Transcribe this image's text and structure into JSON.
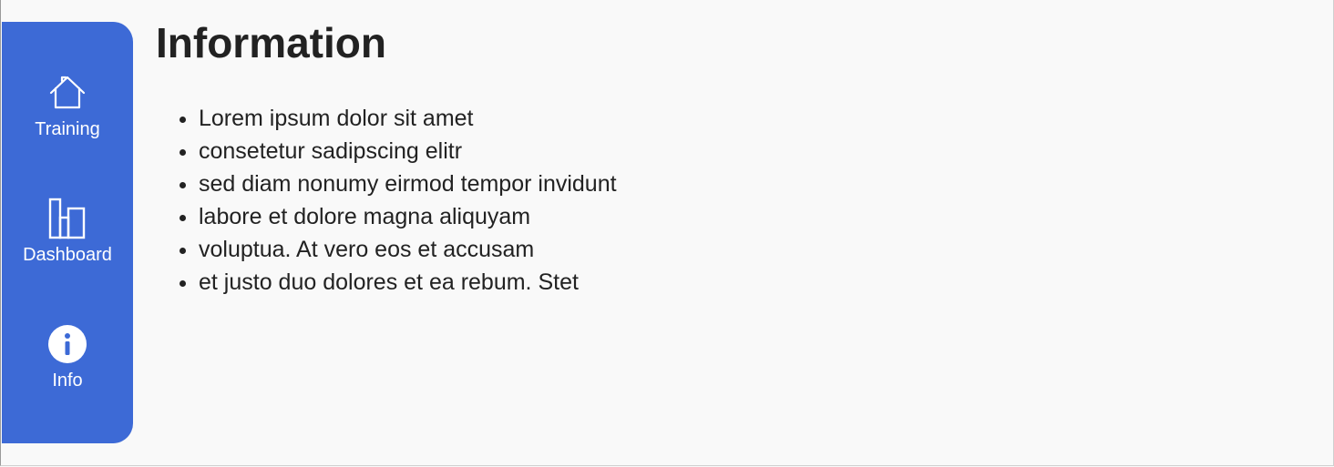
{
  "sidebar": {
    "items": [
      {
        "label": "Training",
        "icon": "home-icon"
      },
      {
        "label": "Dashboard",
        "icon": "bar-chart-icon"
      },
      {
        "label": "Info",
        "icon": "info-icon"
      }
    ]
  },
  "main": {
    "title": "Information",
    "bullets": [
      "Lorem ipsum dolor sit amet",
      "consetetur sadipscing elitr",
      "sed diam nonumy eirmod tempor invidunt",
      "labore et dolore magna aliquyam",
      "voluptua. At vero eos et accusam",
      "et justo duo dolores et ea rebum. Stet"
    ]
  },
  "colors": {
    "sidebar": "#3d6ad6",
    "background": "#f9f9f9",
    "text": "#222222"
  }
}
